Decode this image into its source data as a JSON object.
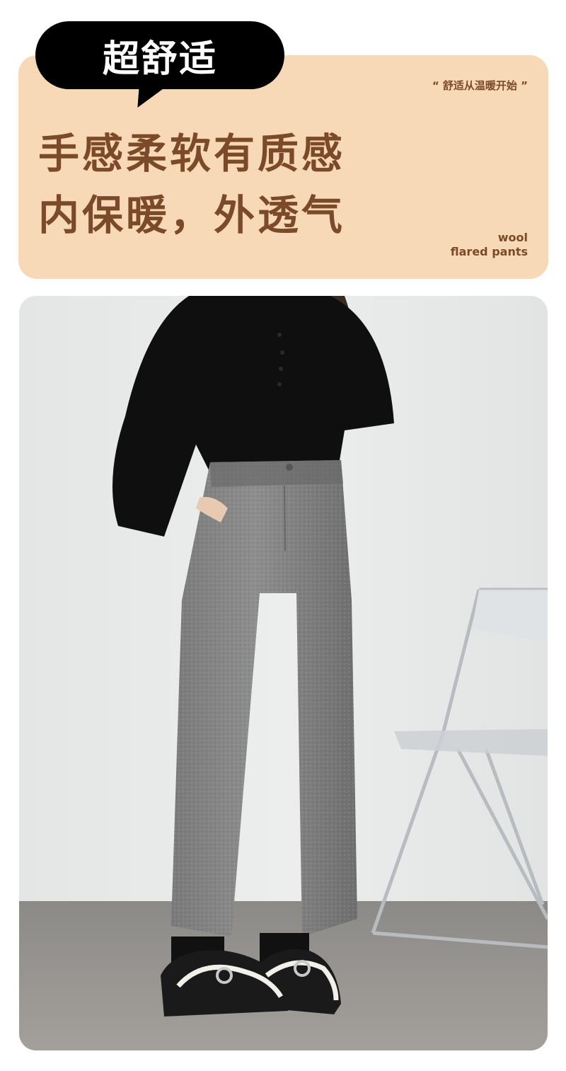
{
  "badge": {
    "text": "超舒适"
  },
  "tagline": "“ 舒适从温暖开始 ”",
  "headline": {
    "line1": "手感柔软有质感",
    "line2": "内保暖，外透气"
  },
  "english": {
    "line1": "wool",
    "line2": "flared pants"
  },
  "colors": {
    "card_bg": "#f8d9b7",
    "accent_text": "#7b4a2a",
    "badge_bg": "#000000"
  },
  "photo": {
    "subject": "woman-in-gray-wool-wide-leg-pants"
  }
}
